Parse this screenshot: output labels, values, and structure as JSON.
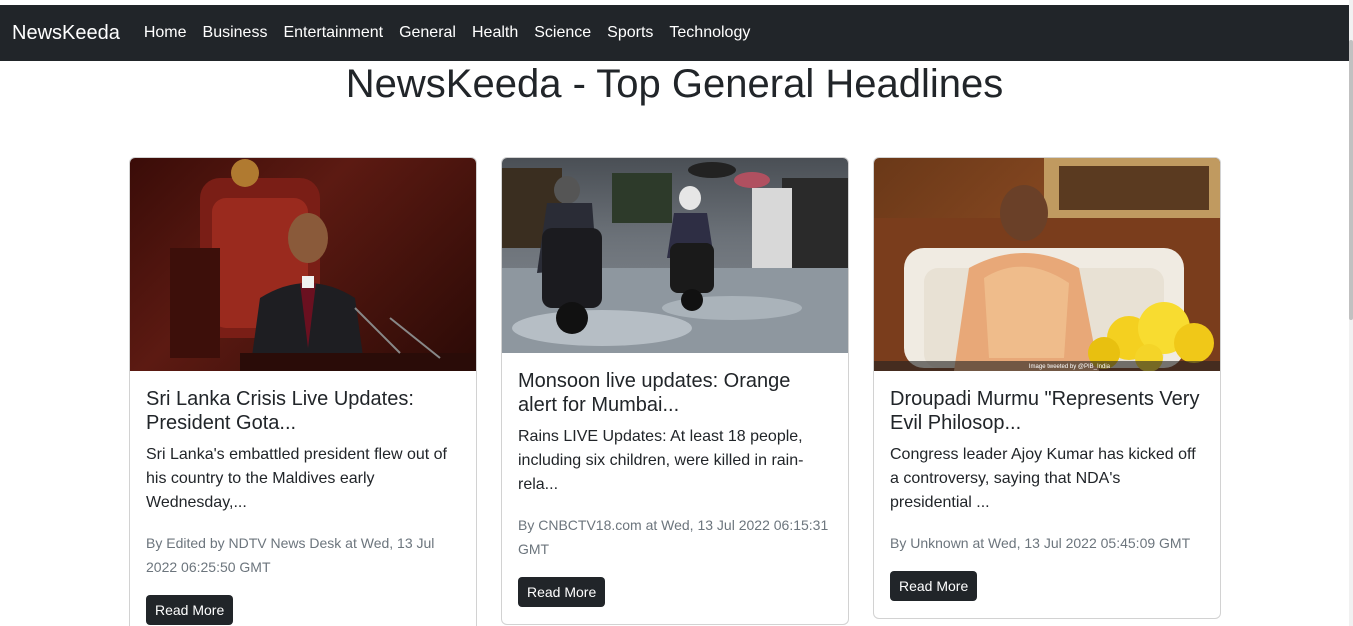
{
  "nav": {
    "brand": "NewsKeeda",
    "links": [
      "Home",
      "Business",
      "Entertainment",
      "General",
      "Health",
      "Science",
      "Sports",
      "Technology"
    ]
  },
  "page": {
    "title": "NewsKeeda - Top General Headlines"
  },
  "cards": [
    {
      "title": "Sri Lanka Crisis Live Updates: President Gota...",
      "description": "Sri Lanka's embattled president flew out of his country to the Maldives early Wednesday,...",
      "meta": "By Edited by NDTV News Desk at Wed, 13 Jul 2022 06:25:50 GMT",
      "button": "Read More"
    },
    {
      "title": "Monsoon live updates: Orange alert for Mumbai...",
      "description": "Rains LIVE Updates: At least 18 people, including six children, were killed in rain-rela...",
      "meta": "By CNBCTV18.com at Wed, 13 Jul 2022 06:15:31 GMT",
      "button": "Read More"
    },
    {
      "title": "Droupadi Murmu \"Represents Very Evil Philosop...",
      "description": "Congress leader Ajoy Kumar has kicked off a controversy, saying that NDA's presidential ...",
      "meta": "By Unknown at Wed, 13 Jul 2022 05:45:09 GMT",
      "button": "Read More",
      "image_caption": "Image tweeted by @PIB_India"
    }
  ]
}
